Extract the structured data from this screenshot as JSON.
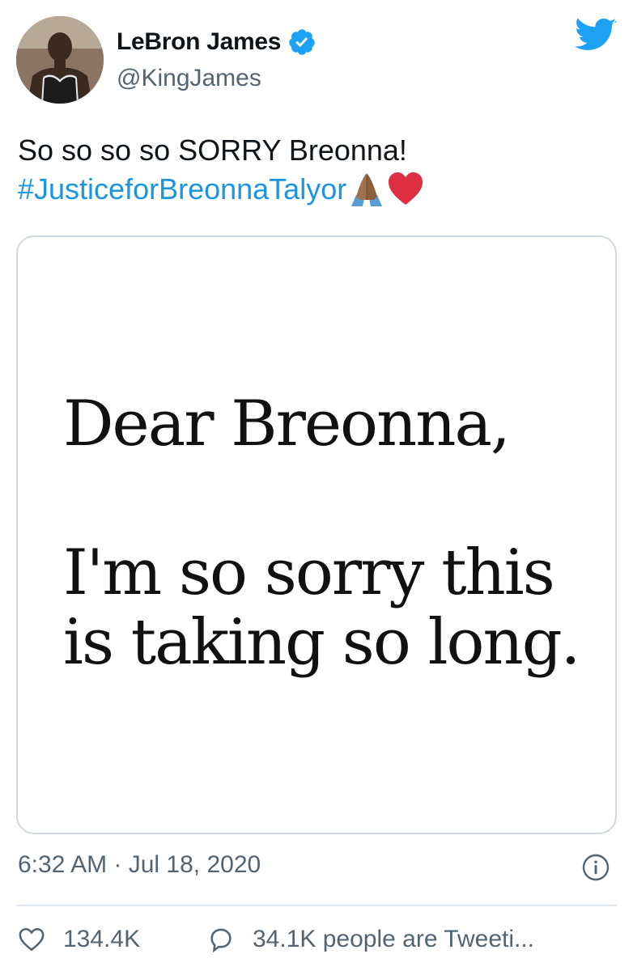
{
  "author": {
    "display_name": "LeBron James",
    "handle": "@KingJames",
    "verified": true,
    "avatar_icon": "profile-photo"
  },
  "brand": {
    "icon": "twitter-bird-icon",
    "color": "#1da1f2"
  },
  "tweet": {
    "text_line1": "So so so so SORRY Breonna!",
    "hashtag": "#JusticeforBreonnaTalyor",
    "emojis": [
      "folded-hands-medium-dark-skin",
      "red-heart"
    ],
    "hashtag_color": "#1b95e0"
  },
  "media": {
    "line1": "Dear Breonna,",
    "line2": "I'm so sorry this",
    "line3": "is taking so long."
  },
  "meta": {
    "timestamp": "6:32 AM · Jul 18, 2020"
  },
  "actions": {
    "likes": "134.4K",
    "tweeting": "34.1K people are Tweeti..."
  }
}
